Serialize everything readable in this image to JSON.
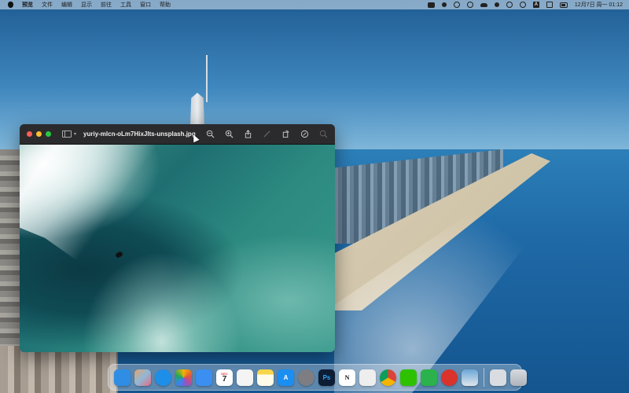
{
  "menubar": {
    "app_name": "预览",
    "menus": [
      "文件",
      "编辑",
      "显示",
      "前往",
      "工具",
      "窗口",
      "帮助"
    ],
    "status_icons": [
      "x-badge-icon",
      "wechat-icon",
      "rss-icon",
      "record-icon",
      "cloud-icon",
      "cat-icon",
      "stop-icon",
      "target-icon",
      "letter-a-icon",
      "toggle-icon",
      "battery-icon"
    ],
    "clock": "12月7日 周一  01:12"
  },
  "window": {
    "title": "yuriy-mlcn-oLm7HixJIts-unsplash.jpg",
    "toolbar": [
      "zoom-out-icon",
      "zoom-in-icon",
      "share-icon",
      "markup-pen-icon",
      "rotate-icon",
      "annotate-icon",
      "search-icon"
    ]
  },
  "dock": {
    "apps": [
      {
        "name": "Finder",
        "icon": "finder-icon",
        "label": "",
        "color": "#2f8de4"
      },
      {
        "name": "Launchpad",
        "icon": "launchpad-icon",
        "label": "",
        "color": "#c9a98a"
      },
      {
        "name": "Safari",
        "icon": "safari-icon",
        "label": "",
        "color": "#1e8fe8"
      },
      {
        "name": "Photos",
        "icon": "photos-icon",
        "label": "",
        "color": "#f2f2f2"
      },
      {
        "name": "Mail",
        "icon": "mail-icon",
        "label": "",
        "color": "#3a8ff0"
      },
      {
        "name": "Calendar",
        "icon": "calendar-icon",
        "month": "DEC",
        "day": "7",
        "color": "#ffffff"
      },
      {
        "name": "Reminders",
        "icon": "reminders-icon",
        "label": "",
        "color": "#f4f4f4"
      },
      {
        "name": "Notes",
        "icon": "notes-icon",
        "label": "",
        "color": "#f8d54a"
      },
      {
        "name": "App Store",
        "icon": "app-store-icon",
        "label": "A",
        "color": "#1b8ef2"
      },
      {
        "name": "System Preferences",
        "icon": "system-preferences-icon",
        "label": "",
        "color": "#7d7d82"
      },
      {
        "name": "Photoshop",
        "icon": "photoshop-icon",
        "label": "Ps",
        "color": "#0d1d33"
      },
      {
        "name": "Notion",
        "icon": "notion-icon",
        "label": "N",
        "color": "#ffffff"
      },
      {
        "name": "QQ",
        "icon": "qq-icon",
        "label": "",
        "color": "#eeeeee"
      },
      {
        "name": "Chrome",
        "icon": "chrome-icon",
        "label": "",
        "color": "#e8e8e8"
      },
      {
        "name": "WeChat",
        "icon": "wechat-icon",
        "label": "",
        "color": "#2dc100"
      },
      {
        "name": "WeChat Work",
        "icon": "wechat-work-icon",
        "label": "",
        "color": "#2bb24c"
      },
      {
        "name": "NetEase Music",
        "icon": "netease-music-icon",
        "label": "",
        "color": "#d9332c"
      },
      {
        "name": "Preview",
        "icon": "preview-icon",
        "label": "",
        "color": "#6aa6d8"
      },
      {
        "name": "Downloads",
        "icon": "downloads-folder-icon",
        "label": "",
        "color": "#d9dde2"
      },
      {
        "name": "Trash",
        "icon": "trash-icon",
        "label": "",
        "color": "#c7ccd1"
      }
    ]
  }
}
